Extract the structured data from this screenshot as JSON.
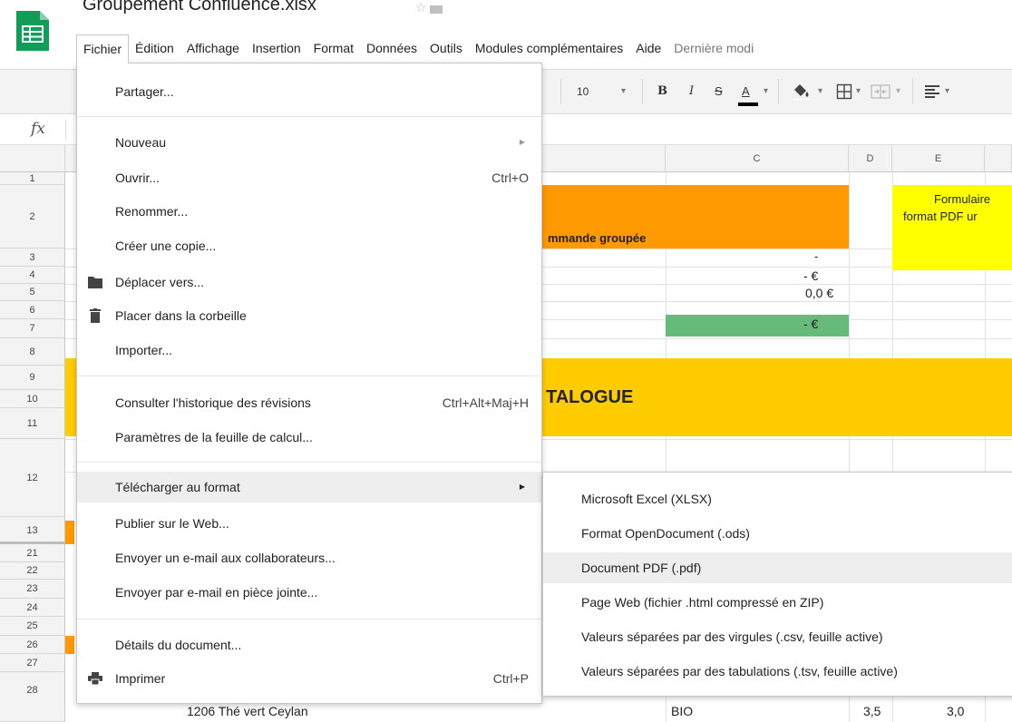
{
  "app": {
    "doc_title": "Groupement Confluence.xlsx",
    "colors": {
      "sheets_green": "#0f9d58",
      "orange": "#ff9900",
      "yellow": "#ffff00",
      "gold": "#ffcc00",
      "green_cell": "#66bb7a",
      "menu_highlight": "#eeeeee"
    }
  },
  "menubar": {
    "items": [
      {
        "label": "Fichier"
      },
      {
        "label": "Édition"
      },
      {
        "label": "Affichage"
      },
      {
        "label": "Insertion"
      },
      {
        "label": "Format"
      },
      {
        "label": "Données"
      },
      {
        "label": "Outils"
      },
      {
        "label": "Modules complémentaires"
      },
      {
        "label": "Aide"
      },
      {
        "label": "Dernière modi"
      }
    ]
  },
  "toolbar": {
    "font_size": "10",
    "dropdown_arrow": "▾",
    "bold": "B",
    "italic": "I",
    "strike": "S",
    "text_color": "A"
  },
  "formula": {
    "fx": "fx"
  },
  "grid": {
    "columns": [
      "C",
      "D",
      "E"
    ],
    "rows": [
      "1",
      "2",
      "3",
      "4",
      "5",
      "6",
      "7",
      "8",
      "9",
      "10",
      "11",
      "12",
      "13",
      "21",
      "22",
      "23",
      "24",
      "25",
      "26",
      "27",
      "28"
    ],
    "cells": {
      "c2": "mmande groupée",
      "e2_line1": "Formulaire",
      "e2_line2": "format PDF ur",
      "c3": "-",
      "c4": "-  €",
      "c5": "0,0 €",
      "c6": "-  €",
      "c9": "TALOGUE",
      "r28_a": "1206  Thé vert Ceylan",
      "r28_c": "BIO",
      "r28_d": "3,5",
      "r28_e": "3,0"
    }
  },
  "file_menu": {
    "items": [
      {
        "label": "Partager..."
      },
      {
        "label": "Nouveau"
      },
      {
        "label": "Ouvrir...",
        "shortcut": "Ctrl+O"
      },
      {
        "label": "Renommer..."
      },
      {
        "label": "Créer une copie..."
      },
      {
        "label": "Déplacer vers..."
      },
      {
        "label": "Placer dans la corbeille"
      },
      {
        "label": "Importer..."
      },
      {
        "label": "Consulter l'historique des révisions",
        "shortcut": "Ctrl+Alt+Maj+H"
      },
      {
        "label": "Paramètres de la feuille de calcul..."
      },
      {
        "label": "Télécharger au format"
      },
      {
        "label": "Publier sur le Web..."
      },
      {
        "label": "Envoyer un e-mail aux collaborateurs..."
      },
      {
        "label": "Envoyer par e-mail en pièce jointe..."
      },
      {
        "label": "Détails du document..."
      },
      {
        "label": "Imprimer",
        "shortcut": "Ctrl+P"
      }
    ],
    "arrow": "▶"
  },
  "download_submenu": {
    "items": [
      {
        "label": "Microsoft Excel (XLSX)"
      },
      {
        "label": "Format OpenDocument (.ods)"
      },
      {
        "label": "Document PDF (.pdf)"
      },
      {
        "label": "Page Web (fichier .html compressé en ZIP)"
      },
      {
        "label": "Valeurs séparées par des virgules (.csv, feuille active)"
      },
      {
        "label": "Valeurs séparées par des tabulations (.tsv, feuille active)"
      }
    ]
  }
}
